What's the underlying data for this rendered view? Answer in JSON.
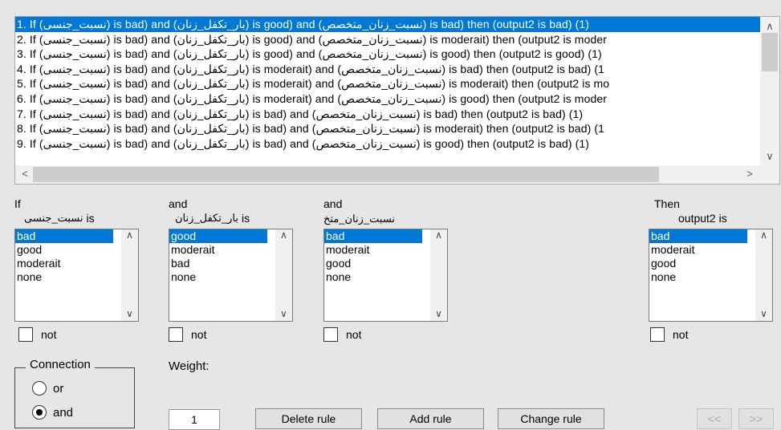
{
  "rules": [
    {
      "n": "1. If (",
      "a": "نسبت_جنسی",
      ", is1": ") is bad) and (",
      "b": "بار_تکفل_زنان",
      "is2": ") is good) and (",
      "c": "نسبت_زنان_متخصص",
      "rest": ") is bad) then (output2 is bad) (1)"
    },
    {
      "n": "2. If (",
      "a": "نسبت_جنسی",
      "is1": ") is bad) and (",
      "b": "بار_تکفل_زنان",
      "is2": ") is good) and (",
      "c": "نسبت_زنان_متخصص",
      "rest": ") is moderait) then (output2 is moder"
    },
    {
      "n": "3. If (",
      "a": "نسبت_جنسی",
      "is1": ") is bad) and (",
      "b": "بار_تکفل_زنان",
      "is2": ") is good) and (",
      "c": "نسبت_زنان_متخصص",
      "rest": ") is good) then (output2 is good) (1)"
    },
    {
      "n": "4. If (",
      "a": "نسبت_جنسی",
      "is1": ") is bad) and (",
      "b": "بار_تکفل_زنان",
      "is2": ") is moderait) and (",
      "c": "نسبت_زنان_متخصص",
      "rest": ") is bad) then (output2 is bad) (1"
    },
    {
      "n": "5. If (",
      "a": "نسبت_جنسی",
      "is1": ") is bad) and (",
      "b": "بار_تکفل_زنان",
      "is2": ") is moderait) and (",
      "c": "نسبت_زنان_متخصص",
      "rest": ") is moderait) then (output2 is mo"
    },
    {
      "n": "6. If (",
      "a": "نسبت_جنسی",
      "is1": ") is bad) and (",
      "b": "بار_تکفل_زنان",
      "is2": ") is moderait) and (",
      "c": "نسبت_زنان_متخصص",
      "rest": ") is good) then (output2 is moder"
    },
    {
      "n": "7. If (",
      "a": "نسبت_جنسی",
      "is1": ") is bad) and (",
      "b": "بار_تکفل_زنان",
      "is2": ") is bad) and (",
      "c": "نسبت_زنان_متخصص",
      "rest": ") is bad) then (output2 is bad) (1)"
    },
    {
      "n": "8. If (",
      "a": "نسبت_جنسی",
      "is1": ") is bad) and (",
      "b": "بار_تکفل_زنان",
      "is2": ") is bad) and (",
      "c": "نسبت_زنان_متخصص",
      "rest": ") is moderait) then (output2 is bad) (1"
    },
    {
      "n": "9. If (",
      "a": "نسبت_جنسی",
      "is1": ") is bad) and (",
      "b": "بار_تکفل_زنان",
      "is2": ") is bad) and (",
      "c": "نسبت_زنان_متخصص",
      "rest": ") is good) then (output2 is bad) (1)"
    }
  ],
  "columns": {
    "col1": {
      "header": "If",
      "var": "نسبت_جنسی",
      "is": "is",
      "items": [
        "bad",
        "good",
        "moderait",
        "none"
      ],
      "not": "not"
    },
    "col2": {
      "header": "and",
      "var": "بار_تکفل_زنان",
      "is": "is",
      "items": [
        "good",
        "moderait",
        "bad",
        "none"
      ],
      "not": "not"
    },
    "col3": {
      "header": "and",
      "var": "نسبت_زنان_متخ",
      "items": [
        "bad",
        "moderait",
        "good",
        "none"
      ],
      "not": "not"
    },
    "col4": {
      "header": "Then",
      "var": "output2 is",
      "items": [
        "bad",
        "moderait",
        "good",
        "none"
      ],
      "not": "not"
    }
  },
  "connection": {
    "title": "Connection",
    "or": "or",
    "and": "and",
    "selected": "and"
  },
  "weight": {
    "label": "Weight:",
    "value": "1"
  },
  "buttons": {
    "delete": "Delete rule",
    "add": "Add rule",
    "change": "Change rule",
    "prev": "<<",
    "next": ">>"
  },
  "icons": {
    "up": "▲",
    "down": "▼",
    "left": "<",
    "right": ">"
  }
}
